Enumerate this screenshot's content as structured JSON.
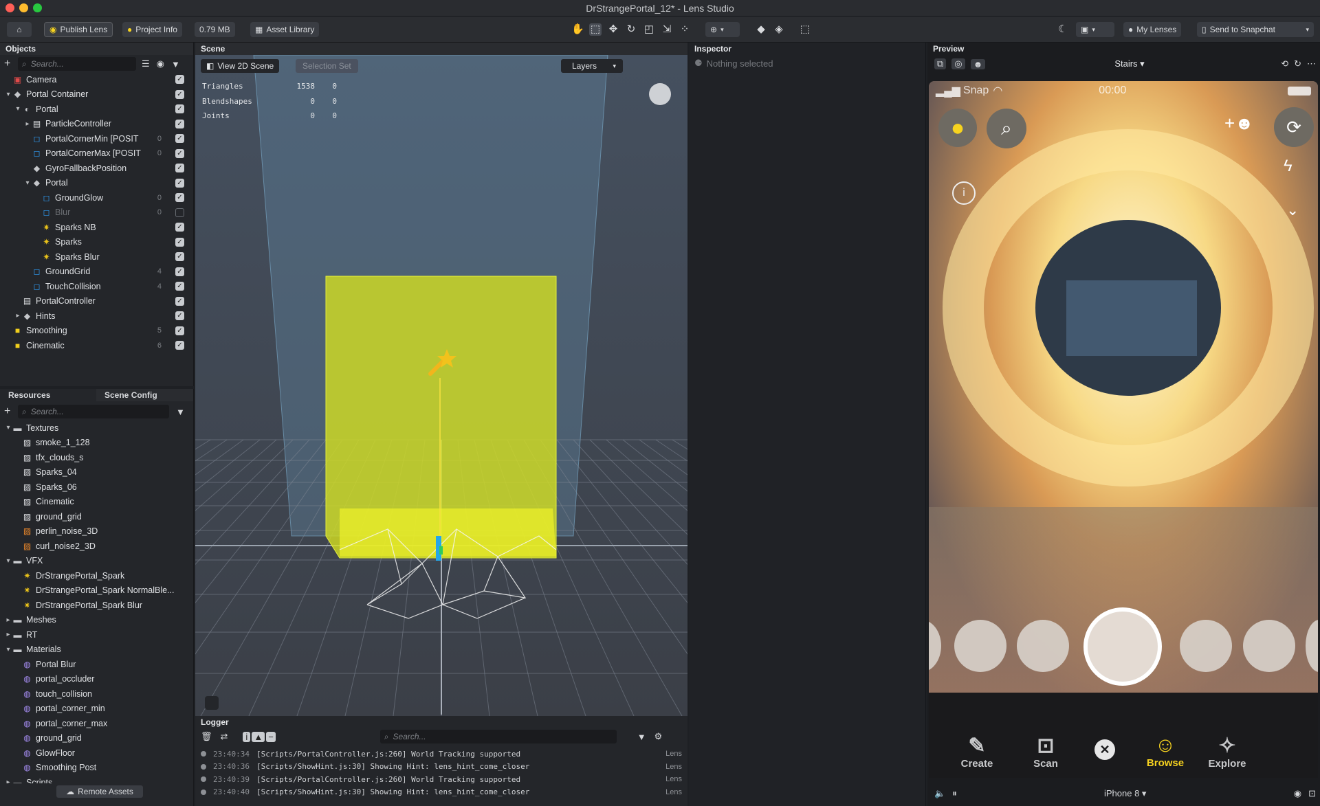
{
  "window": {
    "title": "DrStrangePortal_12* - Lens Studio"
  },
  "toolbar": {
    "publish_label": "Publish Lens",
    "project_info_label": "Project Info",
    "size_label": "0.79 MB",
    "asset_library_label": "Asset Library",
    "my_lenses_label": "My Lenses",
    "send_label": "Send to Snapchat"
  },
  "objects": {
    "header": "Objects",
    "search_placeholder": "Search...",
    "items": [
      {
        "label": "Camera",
        "indent": 0,
        "arrow": "",
        "icon": "camera-icon",
        "count": "",
        "checked": true
      },
      {
        "label": "Portal Container",
        "indent": 0,
        "arrow": "v",
        "icon": "object-icon",
        "count": "",
        "checked": true
      },
      {
        "label": "Portal",
        "indent": 1,
        "arrow": "v",
        "icon": "device-tracking-icon",
        "count": "",
        "checked": true
      },
      {
        "label": "ParticleController",
        "indent": 2,
        "arrow": ">",
        "icon": "script-icon",
        "count": "",
        "checked": true
      },
      {
        "label": "PortalCornerMin [POSIT",
        "indent": 2,
        "arrow": "",
        "icon": "mesh-icon",
        "count": "0",
        "checked": true
      },
      {
        "label": "PortalCornerMax [POSIT",
        "indent": 2,
        "arrow": "",
        "icon": "mesh-icon",
        "count": "0",
        "checked": true
      },
      {
        "label": "GyroFallbackPosition",
        "indent": 2,
        "arrow": "",
        "icon": "object-icon",
        "count": "",
        "checked": true
      },
      {
        "label": "Portal",
        "indent": 2,
        "arrow": "v",
        "icon": "object-icon",
        "count": "",
        "checked": true
      },
      {
        "label": "GroundGlow",
        "indent": 3,
        "arrow": "",
        "icon": "mesh-icon",
        "count": "0",
        "checked": true
      },
      {
        "label": "Blur",
        "indent": 3,
        "arrow": "",
        "icon": "mesh-icon",
        "count": "0",
        "checked": false
      },
      {
        "label": "Sparks NB",
        "indent": 3,
        "arrow": "",
        "icon": "vfx-icon",
        "count": "",
        "checked": true
      },
      {
        "label": "Sparks",
        "indent": 3,
        "arrow": "",
        "icon": "vfx-icon",
        "count": "",
        "checked": true
      },
      {
        "label": "Sparks Blur",
        "indent": 3,
        "arrow": "",
        "icon": "vfx-icon",
        "count": "",
        "checked": true
      },
      {
        "label": "GroundGrid",
        "indent": 2,
        "arrow": "",
        "icon": "mesh-icon",
        "count": "4",
        "checked": true
      },
      {
        "label": "TouchCollision",
        "indent": 2,
        "arrow": "",
        "icon": "mesh-icon",
        "count": "4",
        "checked": true
      },
      {
        "label": "PortalController",
        "indent": 1,
        "arrow": "",
        "icon": "script-icon",
        "count": "",
        "checked": true
      },
      {
        "label": "Hints",
        "indent": 1,
        "arrow": ">",
        "icon": "object-icon",
        "count": "",
        "checked": true
      },
      {
        "label": "Smoothing",
        "indent": 0,
        "arrow": "",
        "icon": "post-effect-icon",
        "count": "5",
        "checked": true
      },
      {
        "label": "Cinematic",
        "indent": 0,
        "arrow": "",
        "icon": "post-effect-icon",
        "count": "6",
        "checked": true
      }
    ]
  },
  "resources": {
    "tab_resources": "Resources",
    "tab_scene_config": "Scene Config",
    "search_placeholder": "Search...",
    "remote_assets_label": "Remote Assets",
    "items": [
      {
        "label": "Textures",
        "indent": 0,
        "arrow": "v",
        "icon": "folder-icon"
      },
      {
        "label": "smoke_1_128",
        "indent": 1,
        "arrow": "",
        "icon": "texture-icon"
      },
      {
        "label": "tfx_clouds_s",
        "indent": 1,
        "arrow": "",
        "icon": "texture-icon"
      },
      {
        "label": "Sparks_04",
        "indent": 1,
        "arrow": "",
        "icon": "texture-icon"
      },
      {
        "label": "Sparks_06",
        "indent": 1,
        "arrow": "",
        "icon": "texture-icon"
      },
      {
        "label": "Cinematic",
        "indent": 1,
        "arrow": "",
        "icon": "texture-icon"
      },
      {
        "label": "ground_grid",
        "indent": 1,
        "arrow": "",
        "icon": "texture-icon"
      },
      {
        "label": "perlin_noise_3D",
        "indent": 1,
        "arrow": "",
        "icon": "texture3d-icon"
      },
      {
        "label": "curl_noise2_3D",
        "indent": 1,
        "arrow": "",
        "icon": "texture3d-icon"
      },
      {
        "label": "VFX",
        "indent": 0,
        "arrow": "v",
        "icon": "folder-icon"
      },
      {
        "label": "DrStrangePortal_Spark",
        "indent": 1,
        "arrow": "",
        "icon": "vfx-icon"
      },
      {
        "label": "DrStrangePortal_Spark NormalBle...",
        "indent": 1,
        "arrow": "",
        "icon": "vfx-icon"
      },
      {
        "label": "DrStrangePortal_Spark Blur",
        "indent": 1,
        "arrow": "",
        "icon": "vfx-icon"
      },
      {
        "label": "Meshes",
        "indent": 0,
        "arrow": ">",
        "icon": "folder-icon"
      },
      {
        "label": "RT",
        "indent": 0,
        "arrow": ">",
        "icon": "folder-icon"
      },
      {
        "label": "Materials",
        "indent": 0,
        "arrow": "v",
        "icon": "folder-icon"
      },
      {
        "label": "Portal Blur",
        "indent": 1,
        "arrow": "",
        "icon": "material-icon"
      },
      {
        "label": "portal_occluder",
        "indent": 1,
        "arrow": "",
        "icon": "material-icon"
      },
      {
        "label": "touch_collision",
        "indent": 1,
        "arrow": "",
        "icon": "material-icon"
      },
      {
        "label": "portal_corner_min",
        "indent": 1,
        "arrow": "",
        "icon": "material-icon"
      },
      {
        "label": "portal_corner_max",
        "indent": 1,
        "arrow": "",
        "icon": "material-icon"
      },
      {
        "label": "ground_grid",
        "indent": 1,
        "arrow": "",
        "icon": "material-icon"
      },
      {
        "label": "GlowFloor",
        "indent": 1,
        "arrow": "",
        "icon": "material-icon"
      },
      {
        "label": "Smoothing Post",
        "indent": 1,
        "arrow": "",
        "icon": "material-icon"
      },
      {
        "label": "Scripts",
        "indent": 0,
        "arrow": ">",
        "icon": "folder-icon"
      }
    ]
  },
  "scene": {
    "header": "Scene",
    "view2d_label": "View 2D Scene",
    "selection_set_label": "Selection Set",
    "layers_label": "Layers",
    "stats": [
      {
        "name": "Triangles",
        "a": "1538",
        "b": "0"
      },
      {
        "name": "Blendshapes",
        "a": "0",
        "b": "0"
      },
      {
        "name": "Joints",
        "a": "0",
        "b": "0"
      }
    ]
  },
  "logger": {
    "header": "Logger",
    "search_placeholder": "Search...",
    "rows": [
      {
        "time": "23:40:34",
        "msg": "[Scripts/PortalController.js:260] World Tracking supported",
        "src": "Lens"
      },
      {
        "time": "23:40:36",
        "msg": "[Scripts/ShowHint.js:30] Showing Hint: lens_hint_come_closer",
        "src": "Lens"
      },
      {
        "time": "23:40:39",
        "msg": "[Scripts/PortalController.js:260] World Tracking supported",
        "src": "Lens"
      },
      {
        "time": "23:40:40",
        "msg": "[Scripts/ShowHint.js:30] Showing Hint: lens_hint_come_closer",
        "src": "Lens"
      }
    ]
  },
  "inspector": {
    "header": "Inspector",
    "empty_text": "Nothing selected"
  },
  "preview": {
    "header": "Preview",
    "scene_select": "Stairs",
    "carrier": "Snap",
    "clock": "00:00",
    "device": "iPhone 8",
    "nav": [
      {
        "label": "Create",
        "icon": "create-icon"
      },
      {
        "label": "Scan",
        "icon": "scan-icon"
      },
      {
        "label": "",
        "icon": "close-icon"
      },
      {
        "label": "Browse",
        "icon": "smile-icon"
      },
      {
        "label": "Explore",
        "icon": "explore-icon"
      }
    ]
  },
  "colors": {
    "accent": "#f7d31f",
    "mesh": "#2f9cf4",
    "vfx": "#e9c21a",
    "material": "#a58cf1"
  }
}
